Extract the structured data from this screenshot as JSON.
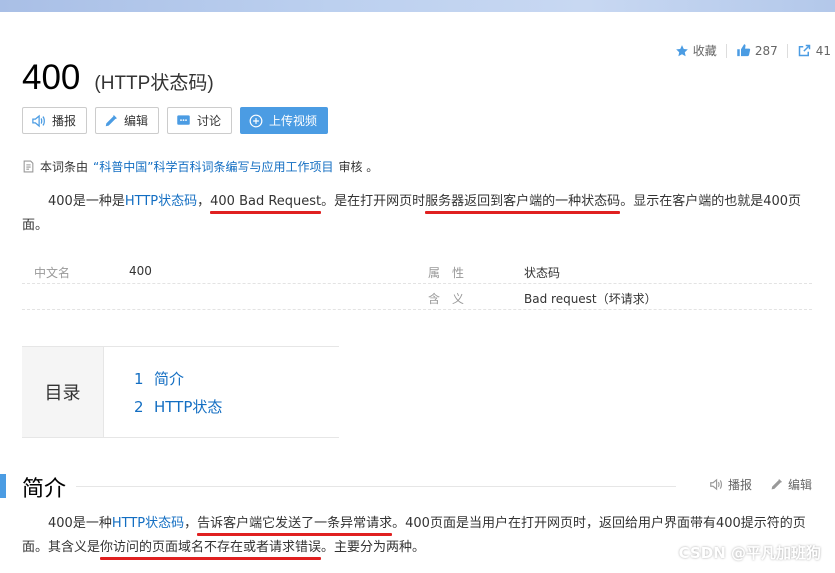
{
  "stats": {
    "favorite_label": "收藏",
    "likes": "287",
    "shares": "41"
  },
  "title": {
    "main": "400",
    "sub": "(HTTP状态码)"
  },
  "toolbar": {
    "report": "播报",
    "edit": "编辑",
    "discuss": "讨论",
    "upload_video": "上传视频"
  },
  "notice": {
    "prefix": "本词条由",
    "link": "“科普中国”科学百科词条编写与应用工作项目",
    "suffix": " 审核 。"
  },
  "intro": {
    "t1": "400是一种是",
    "link1": "HTTP状态码",
    "t2": "，",
    "u1": "400 Bad Request",
    "t3": "。是在打开网页时",
    "u2": "服务器返回到客户端的一种状态码",
    "t4": "。显示在客户端的也就是400页面。"
  },
  "infobox": {
    "rows": [
      {
        "k1": "中文名",
        "v1": "400",
        "k2": "属　性",
        "v2": "状态码"
      },
      {
        "k1": "",
        "v1": "",
        "k2": "含　义",
        "v2": "Bad request（坏请求）"
      }
    ]
  },
  "toc": {
    "title": "目录",
    "items": [
      {
        "num": "1",
        "label": "简介"
      },
      {
        "num": "2",
        "label": "HTTP状态"
      }
    ]
  },
  "section": {
    "title": "简介",
    "report": "播报",
    "edit": "编辑"
  },
  "section_text": {
    "t1": "400是一种",
    "link1": "HTTP状态码",
    "t2": "，",
    "u1": "告诉客户端它发送了一条异常请求",
    "t3": "。400页面是当用户在打开网页时，返回给用户界面带有400提示符的页面。其含义是",
    "u2": "你访问的页面域名不存在或者请求错误",
    "t4": "。主要分为两种。"
  },
  "watermark": "CSDN @平凡加班狗",
  "colors": {
    "link": "#136ec2",
    "primary": "#4b9ce3",
    "underline": "#e02020"
  }
}
